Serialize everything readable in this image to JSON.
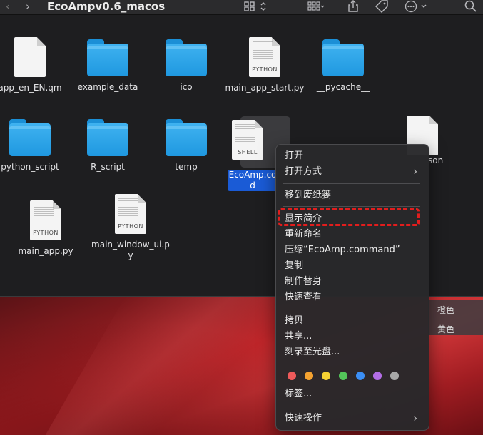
{
  "window": {
    "title": "EcoAmpv0.6_macos"
  },
  "files": [
    {
      "name": "app_en_EN.qm",
      "kind": "document",
      "tag": ""
    },
    {
      "name": "example_data",
      "kind": "folder"
    },
    {
      "name": "ico",
      "kind": "folder"
    },
    {
      "name": "main_app_start.py",
      "kind": "document",
      "tag": "PYTHON"
    },
    {
      "name": "__pycache__",
      "kind": "folder"
    },
    {
      "name": "python_script",
      "kind": "folder"
    },
    {
      "name": "R_script",
      "kind": "folder"
    },
    {
      "name": "temp",
      "kind": "folder"
    },
    {
      "name": "EcoAmp.command",
      "kind": "document",
      "tag": "SHELL",
      "selected": true
    },
    {
      "name": "son",
      "kind": "document",
      "tag": ""
    },
    {
      "name": "main_app.py",
      "kind": "document",
      "tag": "PYTHON"
    },
    {
      "name": "main_window_ui.py",
      "kind": "document",
      "tag": "PYTHON"
    }
  ],
  "selected_label": "EcoAmp.co\nd",
  "side_labels": [
    "橙色",
    "黄色"
  ],
  "context_menu": {
    "items": [
      {
        "label": "打开"
      },
      {
        "label": "打开方式",
        "submenu": true
      },
      {
        "label": "移到废纸篓"
      },
      {
        "label": "显示简介",
        "highlighted": true
      },
      {
        "label": "重新命名"
      },
      {
        "label": "压缩“EcoAmp.command”"
      },
      {
        "label": "复制"
      },
      {
        "label": "制作替身"
      },
      {
        "label": "快速查看"
      },
      {
        "label": "拷贝"
      },
      {
        "label": "共享..."
      },
      {
        "label": "刻录至光盘..."
      },
      {
        "label": "标签..."
      },
      {
        "label": "快速操作",
        "submenu": true
      }
    ],
    "submenu_arrow": "›",
    "tag_colors": [
      "#ee5a5a",
      "#f4a230",
      "#f5d133",
      "#53c65a",
      "#3b8ff5",
      "#b36ee6",
      "#a8a8a8"
    ]
  },
  "icons": {
    "back": "‹",
    "forward": "›"
  }
}
